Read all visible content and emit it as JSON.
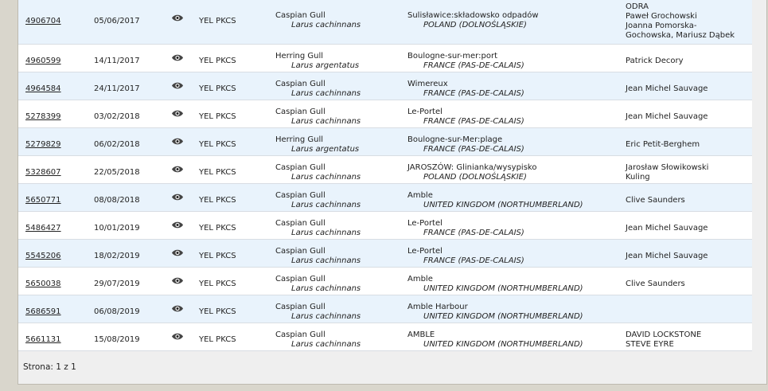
{
  "rows": [
    {
      "id": "4906704",
      "date": "05/06/2017",
      "ring": "YEL PKCS",
      "species": "Caspian Gull",
      "sci": "Larus cachinnans",
      "place": "Sulisławice:składowsko odpadów",
      "country": "POLAND (DOLNOŚLĄSKIE)",
      "observers": [
        "ODRA",
        "Paweł Grochowski",
        "Joanna Pomorska-",
        "Gochowska, Mariusz Dąbek"
      ]
    },
    {
      "id": "4960599",
      "date": "14/11/2017",
      "ring": "YEL PKCS",
      "species": "Herring Gull",
      "sci": "Larus argentatus",
      "place": "Boulogne-sur-mer:port",
      "country": "FRANCE (PAS-DE-CALAIS)",
      "observers": [
        "Patrick Decory"
      ]
    },
    {
      "id": "4964584",
      "date": "24/11/2017",
      "ring": "YEL PKCS",
      "species": "Caspian Gull",
      "sci": "Larus cachinnans",
      "place": "Wimereux",
      "country": "FRANCE (PAS-DE-CALAIS)",
      "observers": [
        "Jean Michel Sauvage"
      ]
    },
    {
      "id": "5278399",
      "date": "03/02/2018",
      "ring": "YEL PKCS",
      "species": "Caspian Gull",
      "sci": "Larus cachinnans",
      "place": "Le-Portel",
      "country": "FRANCE (PAS-DE-CALAIS)",
      "observers": [
        "Jean Michel Sauvage"
      ]
    },
    {
      "id": "5279829",
      "date": "06/02/2018",
      "ring": "YEL PKCS",
      "species": "Herring Gull",
      "sci": "Larus argentatus",
      "place": "Boulogne-sur-Mer:plage",
      "country": "FRANCE (PAS-DE-CALAIS)",
      "observers": [
        "Eric Petit-Berghem"
      ]
    },
    {
      "id": "5328607",
      "date": "22/05/2018",
      "ring": "YEL PKCS",
      "species": "Caspian Gull",
      "sci": "Larus cachinnans",
      "place": "JAROSZÓW: Glinianka/wysypisko",
      "country": "POLAND (DOLNOŚLĄSKIE)",
      "observers": [
        "Jarosław Słowikowski",
        "Kuling"
      ]
    },
    {
      "id": "5650771",
      "date": "08/08/2018",
      "ring": "YEL PKCS",
      "species": "Caspian Gull",
      "sci": "Larus cachinnans",
      "place": "Amble",
      "country": "UNITED KINGDOM (NORTHUMBERLAND)",
      "observers": [
        "Clive Saunders"
      ]
    },
    {
      "id": "5486427",
      "date": "10/01/2019",
      "ring": "YEL PKCS",
      "species": "Caspian Gull",
      "sci": "Larus cachinnans",
      "place": "Le-Portel",
      "country": "FRANCE (PAS-DE-CALAIS)",
      "observers": [
        "Jean Michel Sauvage"
      ]
    },
    {
      "id": "5545206",
      "date": "18/02/2019",
      "ring": "YEL PKCS",
      "species": "Caspian Gull",
      "sci": "Larus cachinnans",
      "place": "Le-Portel",
      "country": "FRANCE (PAS-DE-CALAIS)",
      "observers": [
        "Jean Michel Sauvage"
      ]
    },
    {
      "id": "5650038",
      "date": "29/07/2019",
      "ring": "YEL PKCS",
      "species": "Caspian Gull",
      "sci": "Larus cachinnans",
      "place": "Amble",
      "country": "UNITED KINGDOM (NORTHUMBERLAND)",
      "observers": [
        "Clive Saunders"
      ]
    },
    {
      "id": "5686591",
      "date": "06/08/2019",
      "ring": "YEL PKCS",
      "species": "Caspian Gull",
      "sci": "Larus cachinnans",
      "place": "Amble Harbour",
      "country": "UNITED KINGDOM (NORTHUMBERLAND)",
      "observers": []
    },
    {
      "id": "5661131",
      "date": "15/08/2019",
      "ring": "YEL PKCS",
      "species": "Caspian Gull",
      "sci": "Larus cachinnans",
      "place": "AMBLE",
      "country": "UNITED KINGDOM (NORTHUMBERLAND)",
      "observers": [
        "DAVID LOCKSTONE",
        "STEVE EYRE"
      ]
    }
  ],
  "row_icon": "eye-icon",
  "pager_text": "Strona: 1 z 1"
}
